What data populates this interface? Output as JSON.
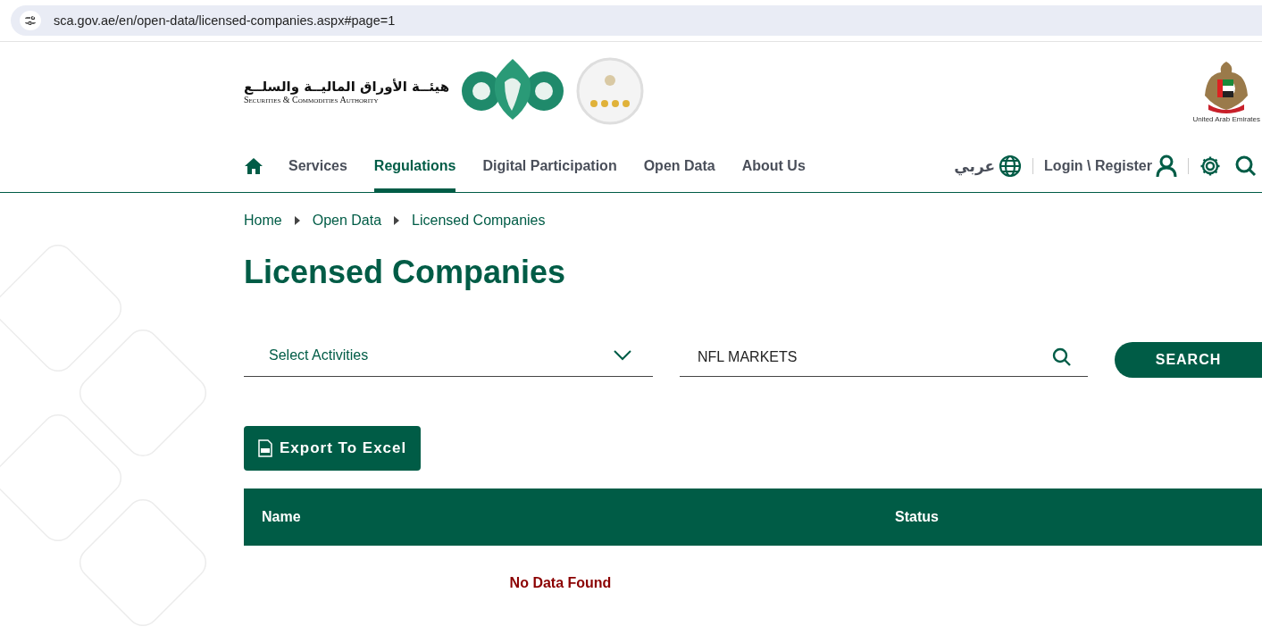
{
  "address_bar": {
    "url": "sca.gov.ae/en/open-data/licensed-companies.aspx#page=1"
  },
  "header": {
    "logo_arabic": "هيئــة الأوراق الماليــة والسلــع",
    "logo_english": "Securities & Commodities Authority",
    "emblem_caption": "United Arab Emirates"
  },
  "nav": {
    "items": [
      {
        "kind": "home",
        "selected": false
      },
      {
        "kind": "link",
        "label": "Services",
        "selected": false
      },
      {
        "kind": "link",
        "label": "Regulations",
        "selected": true
      },
      {
        "kind": "link",
        "label": "Digital Participation",
        "selected": false
      },
      {
        "kind": "link",
        "label": "Open Data",
        "selected": false
      },
      {
        "kind": "link",
        "label": "About Us",
        "selected": false
      }
    ],
    "language": "عربي",
    "login": "Login \\ Register"
  },
  "breadcrumb": [
    "Home",
    "Open Data",
    "Licensed Companies"
  ],
  "title": "Licensed Companies",
  "filters": {
    "activity_select": {
      "placeholder": "Select Activities"
    },
    "search_field": {
      "value": "NFL MARKETS"
    },
    "search_button": "SEARCH"
  },
  "export_button": "Export To Excel",
  "table": {
    "columns": [
      "Name",
      "Status"
    ],
    "empty_message": "No Data Found"
  }
}
